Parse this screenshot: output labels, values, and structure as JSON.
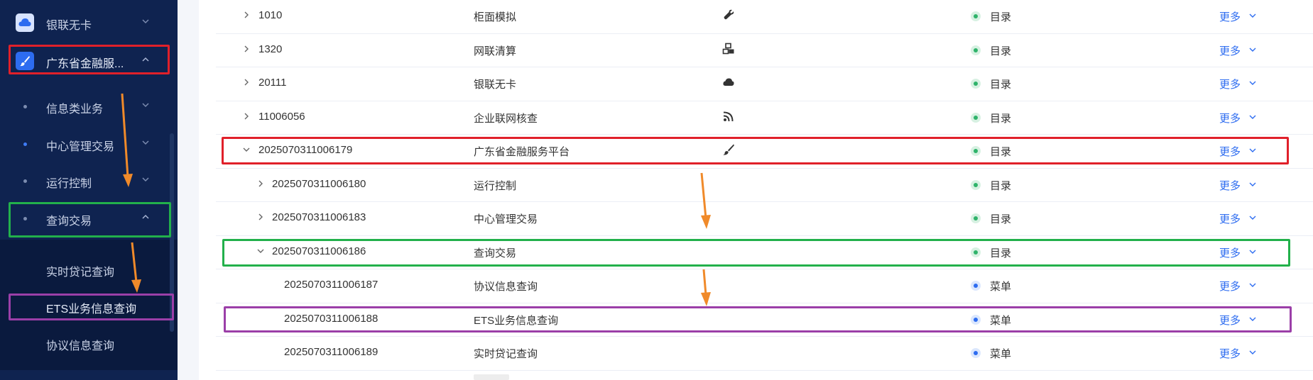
{
  "sidebar": {
    "items": [
      {
        "label": "银联无卡",
        "icon": "cloud-icon",
        "expanded": false
      },
      {
        "label": "广东省金融服...",
        "icon": "brush-icon",
        "expanded": true,
        "active": true
      },
      {
        "label": "信息类业务",
        "expanded": false
      },
      {
        "label": "中心管理交易",
        "expanded": false
      },
      {
        "label": "运行控制",
        "expanded": false
      },
      {
        "label": "查询交易",
        "expanded": true
      }
    ],
    "subitems": [
      {
        "label": "实时贷记查询"
      },
      {
        "label": "ETS业务信息查询"
      },
      {
        "label": "协议信息查询"
      }
    ]
  },
  "table": {
    "rows": [
      {
        "code": "1010",
        "name": "柜面模拟",
        "icon": "wrench-icon",
        "status": "目录",
        "status_type": "green",
        "action": "更多",
        "level": 0,
        "caret": "right"
      },
      {
        "code": "1320",
        "name": "网联清算",
        "icon": "cubes-icon",
        "status": "目录",
        "status_type": "green",
        "action": "更多",
        "level": 0,
        "caret": "right"
      },
      {
        "code": "20111",
        "name": "银联无卡",
        "icon": "cloud-icon",
        "status": "目录",
        "status_type": "green",
        "action": "更多",
        "level": 0,
        "caret": "right"
      },
      {
        "code": "11006056",
        "name": "企业联网核查",
        "icon": "rss-icon",
        "status": "目录",
        "status_type": "green",
        "action": "更多",
        "level": 0,
        "caret": "right"
      },
      {
        "code": "2025070311006179",
        "name": "广东省金融服务平台",
        "icon": "brush-icon",
        "status": "目录",
        "status_type": "green",
        "action": "更多",
        "level": 0,
        "caret": "down"
      },
      {
        "code": "2025070311006180",
        "name": "运行控制",
        "icon": "",
        "status": "目录",
        "status_type": "green",
        "action": "更多",
        "level": 1,
        "caret": "right"
      },
      {
        "code": "2025070311006183",
        "name": "中心管理交易",
        "icon": "",
        "status": "目录",
        "status_type": "green",
        "action": "更多",
        "level": 1,
        "caret": "right"
      },
      {
        "code": "2025070311006186",
        "name": "查询交易",
        "icon": "",
        "status": "目录",
        "status_type": "green",
        "action": "更多",
        "level": 1,
        "caret": "down"
      },
      {
        "code": "2025070311006187",
        "name": "协议信息查询",
        "icon": "",
        "status": "菜单",
        "status_type": "blue",
        "action": "更多",
        "level": 2,
        "caret": "none"
      },
      {
        "code": "2025070311006188",
        "name": "ETS业务信息查询",
        "icon": "",
        "status": "菜单",
        "status_type": "blue",
        "action": "更多",
        "level": 2,
        "caret": "none"
      },
      {
        "code": "2025070311006189",
        "name": "实时贷记查询",
        "icon": "",
        "status": "菜单",
        "status_type": "blue",
        "action": "更多",
        "level": 2,
        "caret": "none"
      }
    ]
  },
  "colors": {
    "red": "#e0202a",
    "green": "#22b04b",
    "purple": "#9b3fa8",
    "orange": "#f08a2a",
    "link": "#2d6cf0"
  }
}
